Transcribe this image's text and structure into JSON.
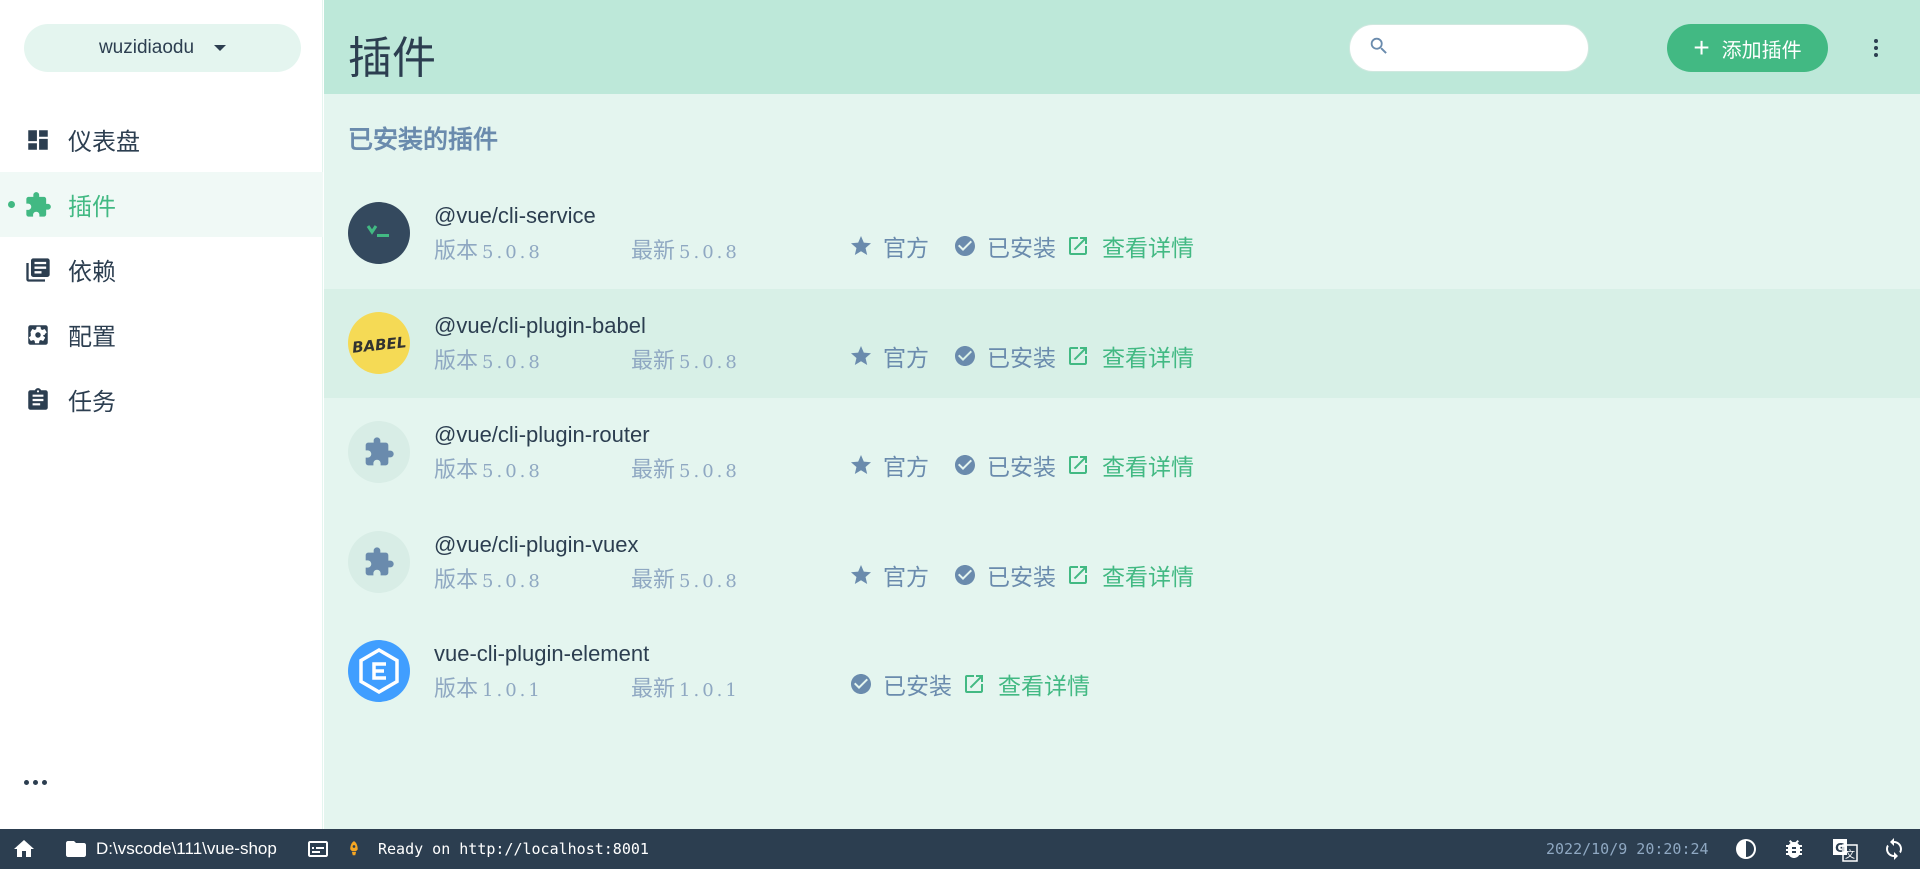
{
  "project": {
    "name": "wuzidiaodu"
  },
  "nav": [
    {
      "label": "仪表盘",
      "icon": "dashboard-icon",
      "active": false
    },
    {
      "label": "插件",
      "icon": "puzzle-icon",
      "active": true
    },
    {
      "label": "依赖",
      "icon": "library-icon",
      "active": false
    },
    {
      "label": "配置",
      "icon": "settings-icon",
      "active": false
    },
    {
      "label": "任务",
      "icon": "clipboard-icon",
      "active": false
    }
  ],
  "header": {
    "title": "插件",
    "search_placeholder": "",
    "add_button": "添加插件"
  },
  "section_title": "已安装的插件",
  "labels": {
    "version": "版本",
    "latest": "最新",
    "official": "官方",
    "installed": "已安装",
    "details": "查看详情"
  },
  "plugins": [
    {
      "name": "@vue/cli-service",
      "version": "5.0.8",
      "latest": "5.0.8",
      "official": true,
      "logo": "vue-cli-logo"
    },
    {
      "name": "@vue/cli-plugin-babel",
      "version": "5.0.8",
      "latest": "5.0.8",
      "official": true,
      "logo": "babel-logo"
    },
    {
      "name": "@vue/cli-plugin-router",
      "version": "5.0.8",
      "latest": "5.0.8",
      "official": true,
      "logo": "puzzle-icon"
    },
    {
      "name": "@vue/cli-plugin-vuex",
      "version": "5.0.8",
      "latest": "5.0.8",
      "official": true,
      "logo": "puzzle-icon"
    },
    {
      "name": "vue-cli-plugin-element",
      "version": "1.0.1",
      "latest": "1.0.1",
      "official": false,
      "logo": "element-logo"
    }
  ],
  "statusbar": {
    "path": "D:\\vscode\\111\\vue-shop",
    "log": "Ready on http://localhost:8001",
    "time": "2022/10/9 20:20:24"
  },
  "colors": {
    "accent": "#42b983",
    "dark": "#2c3e50",
    "muted": "#6a8bad",
    "header_bg": "#bde8d9",
    "content_bg": "#e4f5ef"
  }
}
